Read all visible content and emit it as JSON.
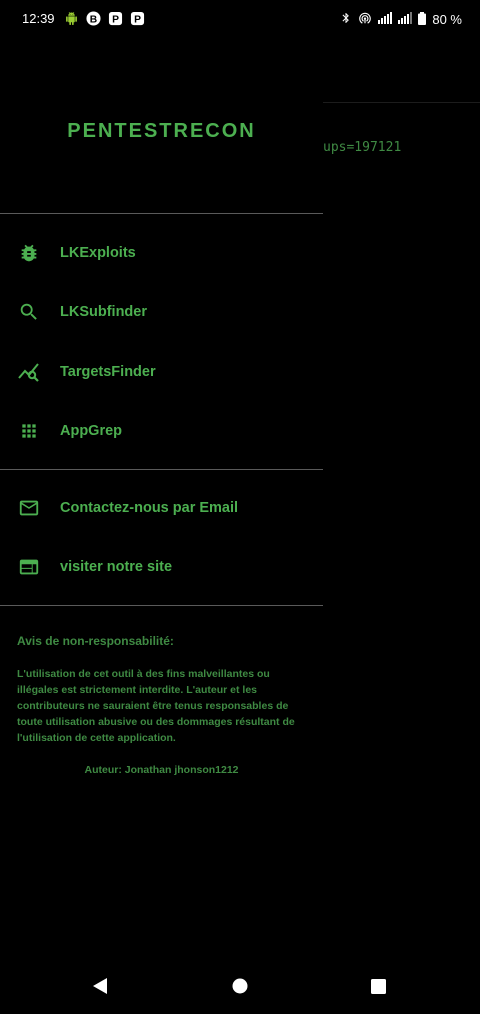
{
  "status_bar": {
    "time": "12:39",
    "battery_percent": "80 %",
    "left_icons": [
      "android-icon",
      "b-badge-icon",
      "p-badge-icon",
      "p-badge-icon"
    ],
    "right_icons": [
      "bluetooth-icon",
      "hotspot-icon",
      "signal-icon",
      "signal-icon",
      "battery-icon"
    ]
  },
  "background_app": {
    "visible_text": "ups=197121"
  },
  "drawer": {
    "title": "PENTESTRECON",
    "menu_primary": [
      {
        "label": "LKExploits",
        "icon": "bug-icon"
      },
      {
        "label": "LKSubfinder",
        "icon": "search-icon"
      },
      {
        "label": "TargetsFinder",
        "icon": "trending-search-icon"
      },
      {
        "label": "AppGrep",
        "icon": "apps-grid-icon"
      }
    ],
    "menu_secondary": [
      {
        "label": "Contactez-nous par Email",
        "icon": "email-icon"
      },
      {
        "label": "visiter notre site",
        "icon": "web-icon"
      }
    ],
    "disclaimer_title": "Avis de non-responsabilité:",
    "disclaimer_text": "L'utilisation de cet outil à des fins malveillantes ou illégales est strictement interdite. L'auteur et les contributeurs ne sauraient être tenus responsables de toute utilisation abusive ou des dommages résultant de l'utilisation de cette application.",
    "author": "Auteur: Jonathan jhonson1212"
  },
  "colors": {
    "accent": "#4caf50",
    "accent_dim": "#3f8a43",
    "background": "#000000",
    "divider": "#5a5a5a"
  }
}
